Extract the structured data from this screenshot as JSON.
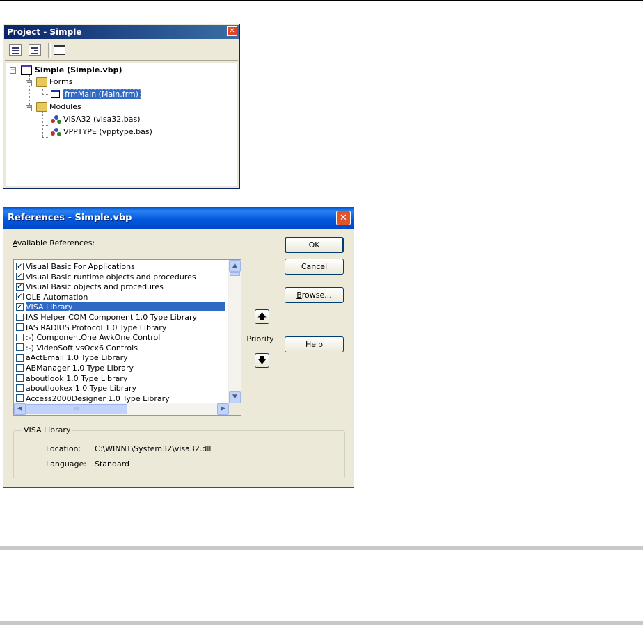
{
  "project": {
    "title": "Project - Simple",
    "close_glyph": "✕",
    "tree": {
      "root": "Simple (Simple.vbp)",
      "forms_folder": "Forms",
      "form_item": "frmMain (Main.frm)",
      "modules_folder": "Modules",
      "modules": [
        "VISA32 (visa32.bas)",
        "VPPTYPE (vpptype.bas)"
      ]
    }
  },
  "references": {
    "title": "References - Simple.vbp",
    "close_glyph": "✕",
    "available_label_underlined": "A",
    "available_label_rest": "vailable References:",
    "items": [
      {
        "label": "Visual Basic For Applications",
        "checked": true
      },
      {
        "label": "Visual Basic runtime objects and procedures",
        "checked": true
      },
      {
        "label": "Visual Basic objects and procedures",
        "checked": true
      },
      {
        "label": "OLE Automation",
        "checked": true
      },
      {
        "label": "VISA Library",
        "checked": true,
        "selected": true
      },
      {
        "label": "IAS Helper COM Component 1.0 Type Library",
        "checked": false
      },
      {
        "label": "IAS RADIUS Protocol 1.0 Type Library",
        "checked": false
      },
      {
        "label": ":-) ComponentOne AwkOne Control",
        "checked": false
      },
      {
        "label": ":-) VideoSoft vsOcx6 Controls",
        "checked": false
      },
      {
        "label": "aActEmail 1.0 Type Library",
        "checked": false
      },
      {
        "label": "ABManager 1.0 Type Library",
        "checked": false
      },
      {
        "label": "aboutlook 1.0 Type Library",
        "checked": false
      },
      {
        "label": "aboutlookex 1.0 Type Library",
        "checked": false
      },
      {
        "label": "Access2000Designer 1.0 Type Library",
        "checked": false
      }
    ],
    "buttons": {
      "ok": "OK",
      "cancel": "Cancel",
      "browse_underlined": "B",
      "browse_rest": "rowse...",
      "help_underlined": "H",
      "help_rest": "elp"
    },
    "priority_label": "Priority",
    "priority_up_glyph": "🡅",
    "priority_down_glyph": "🡇",
    "scroll_up_glyph": "▲",
    "scroll_down_glyph": "▼",
    "scroll_left_glyph": "◀",
    "scroll_right_glyph": "▶",
    "scroll_thumb_grip": "III",
    "details": {
      "group_title": "VISA Library",
      "location_label": "Location:",
      "location_value": "C:\\WINNT\\System32\\visa32.dll",
      "language_label": "Language:",
      "language_value": "Standard"
    }
  },
  "colors": {
    "selection": "#316ac5",
    "xp_title_blue": "#0058e0",
    "classic_title": "#0a246a",
    "dialog_face": "#ece9d8"
  }
}
